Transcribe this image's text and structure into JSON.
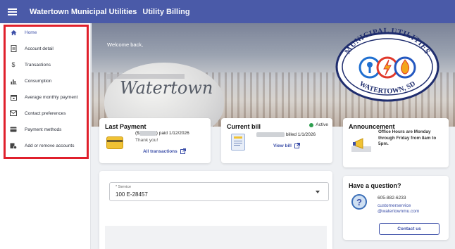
{
  "header": {
    "title": "Watertown Municipal Utilities",
    "subtitle": "Utility Billing"
  },
  "sidebar": {
    "items": [
      {
        "label": "Home",
        "icon": "home-icon"
      },
      {
        "label": "Account detail",
        "icon": "document-icon"
      },
      {
        "label": "Transactions",
        "icon": "dollar-icon"
      },
      {
        "label": "Consumption",
        "icon": "bar-chart-icon"
      },
      {
        "label": "Average monthly payment",
        "icon": "calendar-icon"
      },
      {
        "label": "Contact preferences",
        "icon": "envelope-icon"
      },
      {
        "label": "Payment methods",
        "icon": "credit-card-icon"
      },
      {
        "label": "Add or remove accounts",
        "icon": "accounts-icon"
      }
    ]
  },
  "hero": {
    "welcome": "Welcome back,",
    "script_text": "Watertown",
    "logo_top": "MUNICIPAL UTILITIES",
    "logo_bottom": "WATERTOWN, SD"
  },
  "last_payment": {
    "title": "Last Payment",
    "amount_prefix": "($",
    "paid_text": ") paid 1/12/2026",
    "thanks": "Thank you!",
    "link": "All transactions"
  },
  "current_bill": {
    "title": "Current bill",
    "status": "Active",
    "billed_text": "billed 1/1/2026",
    "link": "View bill"
  },
  "announcement": {
    "title": "Announcement",
    "text": "Office Hours are Monday through Friday from 8am to 5pm."
  },
  "service": {
    "label": "* Service",
    "value": "100 E-28457"
  },
  "question": {
    "title": "Have a question?",
    "phone": "605-882-6233",
    "email_line1": "customerservice",
    "email_line2": "@watertownmu.com",
    "button": "Contact us"
  },
  "colors": {
    "brand": "#4a5aa8",
    "accent": "#3c4fa8",
    "active": "#2e9e4f",
    "highlight": "#e0202c"
  }
}
